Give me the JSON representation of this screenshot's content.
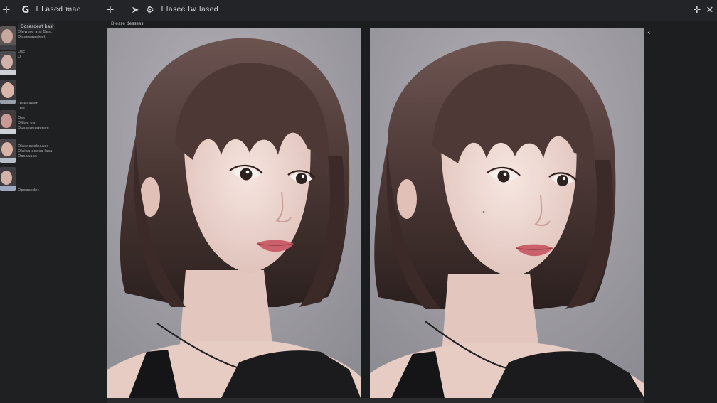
{
  "toolbar": {
    "app_title": "I Lased mad",
    "doc_title": "I lasee lw lased"
  },
  "sidebar": {
    "header": "Dosasdeat basl",
    "items": [
      {
        "lines": [
          "Dlewere alsl Dest",
          "Dlsseeaaeleet"
        ]
      },
      {
        "lines": [
          "Dsc",
          "D"
        ]
      },
      {
        "lines": [
          "Dsieaaeer",
          "Dss"
        ]
      },
      {
        "lines": [
          "Dss",
          "Dlilae ea",
          "Dosasaeaaeeae"
        ]
      },
      {
        "lines": [
          "Dlasaeaeleaaes",
          "Dlaiaa edasa lasa",
          "Dosaaaas"
        ]
      },
      {
        "lines": [
          "Dpooasdet"
        ]
      }
    ]
  },
  "main": {
    "panel_label": "Dlesse desssas"
  },
  "colors": {
    "background": "#1c1d1f",
    "toolbar": "#232427",
    "panel_backdrop": "#9a989e",
    "hair": "#4a3734"
  },
  "icons": [
    "plus-move-icon",
    "app-logo-icon",
    "arrow-back-icon",
    "settings-icon",
    "collapse-icon",
    "close-icon"
  ]
}
